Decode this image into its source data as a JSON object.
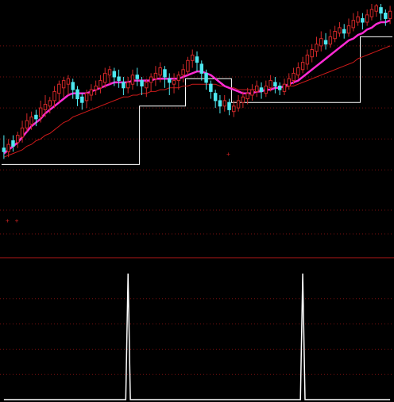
{
  "chart_data": {
    "type": "candlestick",
    "title": "",
    "xlabel": "",
    "ylabel": "",
    "panels": [
      {
        "name": "price",
        "ylim": [
          0,
          100
        ],
        "grid": "dotted-horizontal",
        "grid_levels": [
          9,
          26,
          43,
          60,
          77
        ],
        "candles": [
          [
            21,
            19,
            28,
            15
          ],
          [
            19,
            23,
            26,
            16
          ],
          [
            25,
            22,
            28,
            19
          ],
          [
            24,
            28,
            30,
            21
          ],
          [
            27,
            32,
            36,
            24
          ],
          [
            32,
            36,
            40,
            30
          ],
          [
            34,
            38,
            41,
            31
          ],
          [
            39,
            37,
            42,
            33
          ],
          [
            38,
            43,
            47,
            35
          ],
          [
            42,
            45,
            50,
            38
          ],
          [
            44,
            47,
            49,
            40
          ],
          [
            47,
            52,
            55,
            43
          ],
          [
            51,
            56,
            58,
            46
          ],
          [
            54,
            58,
            60,
            49
          ],
          [
            56,
            59,
            61,
            50
          ],
          [
            57,
            53,
            59,
            48
          ],
          [
            53,
            48,
            55,
            44
          ],
          [
            49,
            46,
            51,
            42
          ],
          [
            47,
            51,
            53,
            43
          ],
          [
            50,
            53,
            56,
            47
          ],
          [
            53,
            55,
            58,
            50
          ],
          [
            54,
            58,
            61,
            51
          ],
          [
            57,
            62,
            65,
            54
          ],
          [
            61,
            64,
            66,
            56
          ],
          [
            63,
            60,
            65,
            55
          ],
          [
            60,
            58,
            64,
            54
          ],
          [
            57,
            54,
            60,
            50
          ],
          [
            54,
            57,
            60,
            51
          ],
          [
            56,
            61,
            64,
            53
          ],
          [
            61,
            59,
            65,
            55
          ],
          [
            58,
            55,
            60,
            50
          ],
          [
            54,
            57,
            59,
            49
          ],
          [
            57,
            60,
            62,
            52
          ],
          [
            59,
            62,
            66,
            55
          ],
          [
            61,
            65,
            68,
            57
          ],
          [
            64,
            60,
            66,
            54
          ],
          [
            59,
            57,
            62,
            50
          ],
          [
            56,
            58,
            62,
            51
          ],
          [
            58,
            61,
            63,
            53
          ],
          [
            61,
            64,
            67,
            57
          ],
          [
            63,
            69,
            71,
            61
          ],
          [
            69,
            72,
            75,
            65
          ],
          [
            71,
            68,
            74,
            63
          ],
          [
            67,
            62,
            69,
            58
          ],
          [
            62,
            57,
            64,
            53
          ],
          [
            56,
            52,
            58,
            48
          ],
          [
            51,
            47,
            53,
            43
          ],
          [
            47,
            44,
            50,
            40
          ],
          [
            44,
            47,
            50,
            41
          ],
          [
            46,
            42,
            48,
            39
          ],
          [
            41,
            44,
            47,
            38
          ],
          [
            43,
            47,
            50,
            41
          ],
          [
            46,
            49,
            52,
            43
          ],
          [
            48,
            51,
            54,
            45
          ],
          [
            50,
            53,
            56,
            47
          ],
          [
            52,
            55,
            58,
            49
          ],
          [
            54,
            52,
            57,
            48
          ],
          [
            51,
            55,
            58,
            49
          ],
          [
            54,
            58,
            61,
            52
          ],
          [
            57,
            55,
            60,
            51
          ],
          [
            55,
            53,
            57,
            50
          ],
          [
            52,
            56,
            59,
            50
          ],
          [
            55,
            59,
            62,
            53
          ],
          [
            58,
            62,
            65,
            56
          ],
          [
            61,
            65,
            68,
            59
          ],
          [
            64,
            68,
            71,
            62
          ],
          [
            67,
            72,
            75,
            64
          ],
          [
            71,
            75,
            78,
            68
          ],
          [
            74,
            78,
            82,
            71
          ],
          [
            77,
            81,
            85,
            74
          ],
          [
            80,
            78,
            84,
            75
          ],
          [
            78,
            82,
            86,
            76
          ],
          [
            81,
            85,
            88,
            79
          ],
          [
            84,
            87,
            90,
            82
          ],
          [
            86,
            84,
            89,
            81
          ],
          [
            84,
            88,
            92,
            82
          ],
          [
            87,
            91,
            95,
            85
          ],
          [
            90,
            93,
            96,
            88
          ],
          [
            92,
            90,
            95,
            86
          ],
          [
            90,
            94,
            97,
            88
          ],
          [
            93,
            97,
            100,
            91
          ],
          [
            96,
            99,
            100,
            93
          ],
          [
            98,
            95,
            100,
            91
          ],
          [
            95,
            92,
            97,
            88
          ],
          [
            92,
            96,
            99,
            89
          ]
        ],
        "ma_fast": [
          18,
          20,
          22,
          24,
          27,
          30,
          33,
          35,
          37,
          40,
          42,
          44,
          46,
          48,
          50,
          51,
          51,
          51,
          51,
          52,
          53,
          54,
          55,
          56,
          57,
          57,
          57,
          57,
          58,
          58,
          58,
          58,
          58,
          59,
          59,
          59,
          59,
          59,
          59,
          60,
          61,
          62,
          63,
          63,
          62,
          61,
          59,
          57,
          55,
          54,
          53,
          52,
          51,
          51,
          51,
          52,
          52,
          53,
          53,
          54,
          54,
          55,
          56,
          57,
          58,
          60,
          62,
          64,
          66,
          68,
          70,
          72,
          74,
          76,
          78,
          80,
          81,
          83,
          84,
          86,
          87,
          89,
          90,
          90,
          91
        ],
        "ma_slow": [
          16,
          17,
          18,
          19,
          20,
          22,
          23,
          25,
          26,
          28,
          29,
          31,
          33,
          35,
          36,
          38,
          39,
          40,
          41,
          42,
          43,
          44,
          45,
          46,
          47,
          48,
          49,
          49,
          50,
          50,
          51,
          51,
          52,
          52,
          53,
          53,
          54,
          54,
          54,
          55,
          55,
          56,
          56,
          56,
          56,
          56,
          56,
          55,
          55,
          54,
          54,
          53,
          53,
          53,
          53,
          53,
          53,
          53,
          53,
          54,
          54,
          54,
          55,
          55,
          56,
          57,
          58,
          59,
          60,
          61,
          62,
          63,
          64,
          65,
          66,
          67,
          68,
          70,
          71,
          72,
          73,
          74,
          75,
          76,
          77
        ],
        "stop_line": [
          12,
          12,
          12,
          12,
          12,
          12,
          12,
          12,
          12,
          12,
          12,
          12,
          12,
          12,
          12,
          12,
          12,
          12,
          12,
          12,
          12,
          12,
          12,
          12,
          12,
          12,
          12,
          12,
          12,
          12,
          44,
          44,
          44,
          44,
          44,
          44,
          44,
          44,
          44,
          44,
          59,
          59,
          59,
          59,
          59,
          59,
          59,
          59,
          59,
          59,
          46,
          46,
          46,
          46,
          46,
          46,
          46,
          46,
          46,
          46,
          46,
          46,
          46,
          46,
          46,
          46,
          46,
          46,
          46,
          46,
          46,
          46,
          46,
          46,
          46,
          46,
          46,
          46,
          82,
          82,
          82,
          82,
          82,
          82,
          82
        ],
        "colors": {
          "up": "#d02828",
          "down": "#4ee8f0",
          "ma_fast": "#ff2ad4",
          "ma_slow": "#cc1a1a",
          "stop": "#ffffff",
          "grid": "#7a1010"
        }
      },
      {
        "name": "signal",
        "ylim": [
          0,
          100
        ],
        "grid": "dotted-horizontal",
        "grid_levels": [
          20,
          40,
          60,
          80
        ],
        "signals": [
          0,
          0,
          0,
          0,
          0,
          0,
          0,
          0,
          0,
          0,
          0,
          0,
          0,
          0,
          0,
          0,
          0,
          0,
          0,
          0,
          0,
          0,
          0,
          0,
          0,
          0,
          0,
          100,
          0,
          0,
          0,
          0,
          0,
          0,
          0,
          0,
          0,
          0,
          0,
          0,
          0,
          0,
          0,
          0,
          0,
          0,
          0,
          0,
          0,
          0,
          0,
          0,
          0,
          0,
          0,
          0,
          0,
          0,
          0,
          0,
          0,
          0,
          0,
          0,
          0,
          100,
          0,
          0,
          0,
          0,
          0,
          0,
          0,
          0,
          0,
          0,
          0,
          0,
          0,
          0,
          0,
          0,
          0,
          0,
          0
        ],
        "colors": {
          "signal": "#ffffff",
          "grid": "#7a1010"
        }
      }
    ]
  }
}
